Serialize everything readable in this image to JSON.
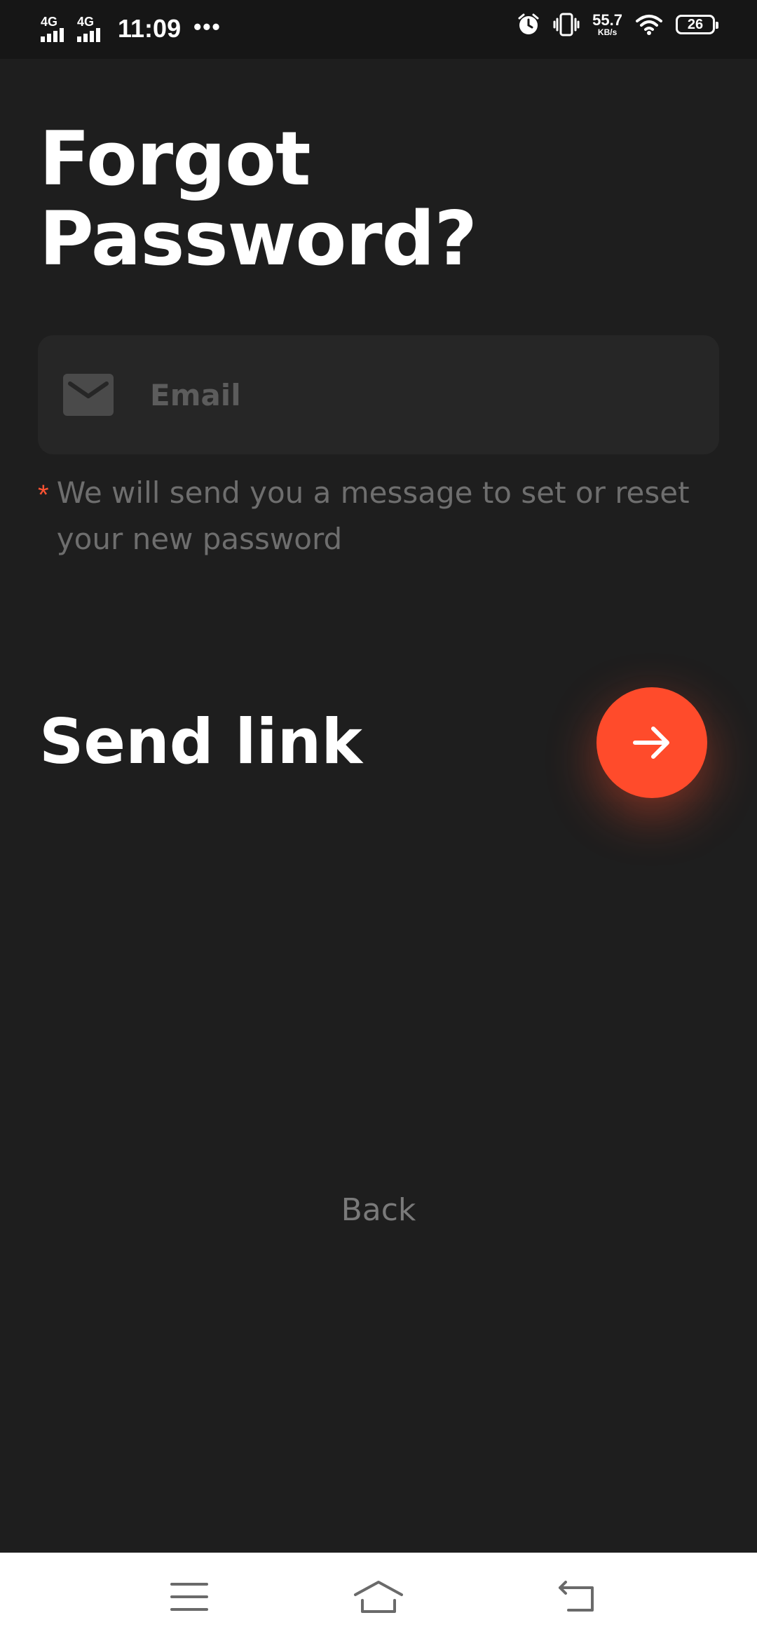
{
  "status_bar": {
    "network_1": "4G",
    "network_2": "4G",
    "time": "11:09",
    "more": "•••",
    "speed_value": "55.7",
    "speed_unit": "KB/s",
    "battery": "26",
    "icons": [
      "alarm-icon",
      "vibrate-icon",
      "wifi-icon",
      "battery-icon"
    ]
  },
  "page": {
    "title_line1": "Forgot",
    "title_line2": "Password?"
  },
  "email_field": {
    "placeholder": "Email",
    "value": "",
    "icon": "mail-icon"
  },
  "hint": {
    "marker": "*",
    "text": "We will send you a message to set or reset your new password"
  },
  "send": {
    "label": "Send link",
    "icon": "arrow-right-icon"
  },
  "back": {
    "label": "Back"
  },
  "nav_bar": {
    "icons": [
      "menu-icon",
      "home-icon",
      "back-icon"
    ]
  },
  "colors": {
    "background": "#1e1e1e",
    "field_background": "#262626",
    "accent": "#ff4b2b",
    "muted_text": "#6e6e6e"
  }
}
